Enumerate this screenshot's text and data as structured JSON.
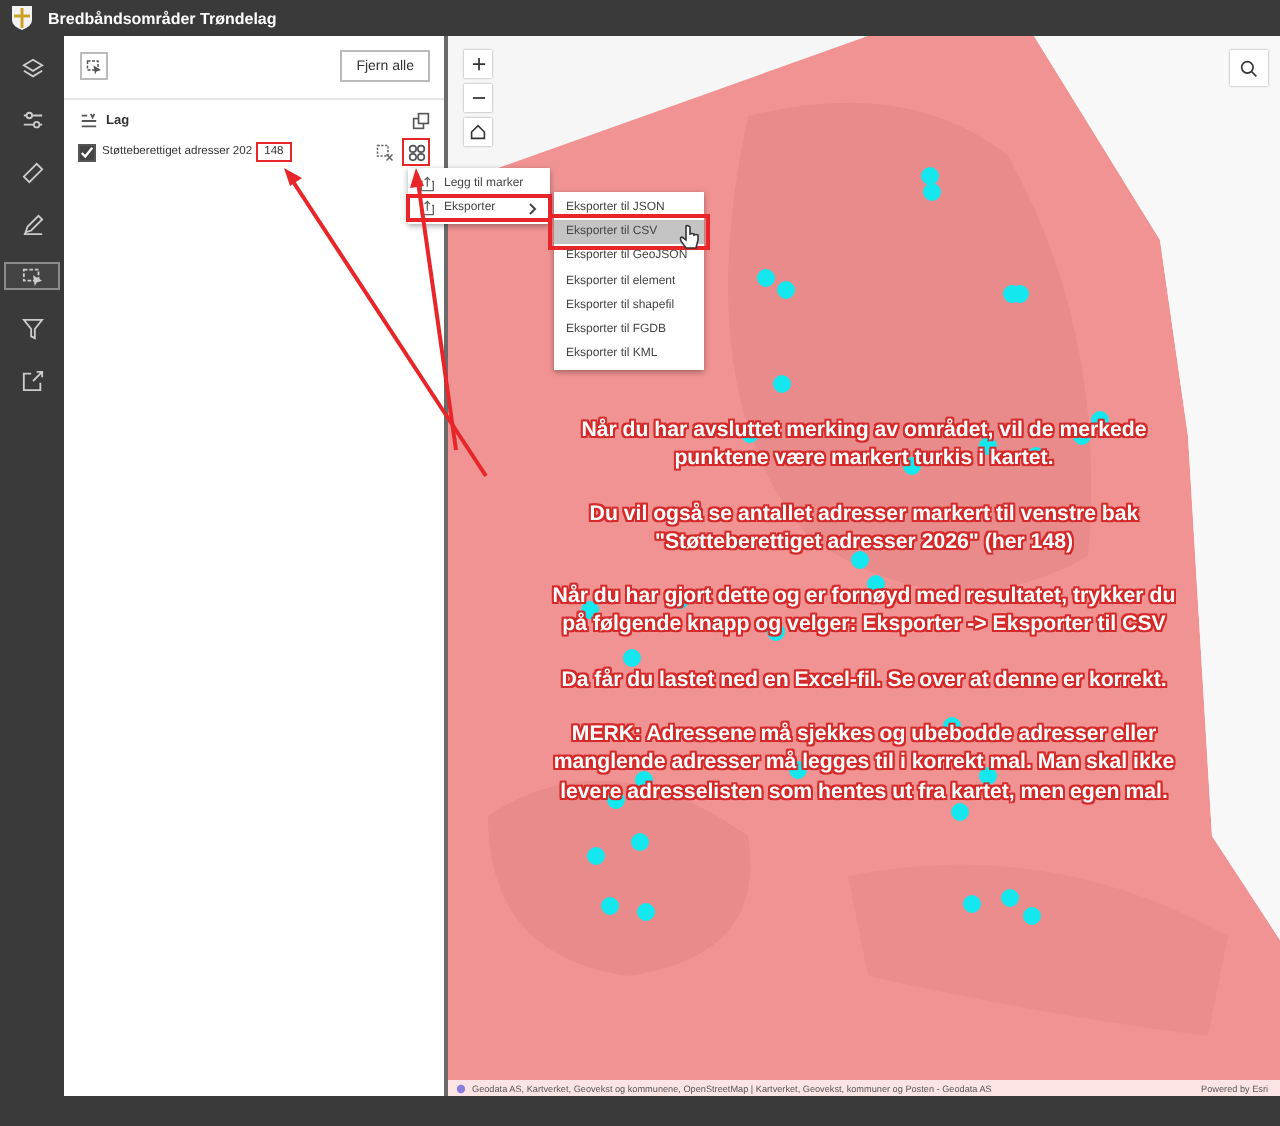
{
  "header": {
    "title": "Bredbåndsområder Trøndelag"
  },
  "rail": {
    "items": [
      {
        "selected": false
      },
      {
        "selected": false
      },
      {
        "selected": false
      },
      {
        "selected": false
      },
      {
        "selected": true
      },
      {
        "selected": false
      },
      {
        "selected": false
      }
    ]
  },
  "panel": {
    "clear_button": "Fjern alle",
    "section_title": "Lag",
    "layers": [
      {
        "label": "Støtteberettiget adresser 202",
        "checked": true,
        "count": "148",
        "count_highlighted": true,
        "actions_highlighted": true
      }
    ]
  },
  "layer_menu": {
    "items": [
      {
        "label": "Legg til marker",
        "has_submenu": false,
        "highlighted": false
      },
      {
        "label": "Eksporter",
        "has_submenu": true,
        "highlighted": true
      }
    ]
  },
  "export_menu": {
    "items": [
      {
        "label": "Eksporter til JSON",
        "selected": false,
        "highlighted": false
      },
      {
        "label": "Eksporter til CSV",
        "selected": true,
        "highlighted": true
      },
      {
        "label": "Eksporter til GeoJSON",
        "selected": false,
        "highlighted": false
      },
      {
        "label": "Eksporter til element",
        "selected": false,
        "highlighted": false
      },
      {
        "label": "Eksporter til shapefil",
        "selected": false,
        "highlighted": false
      },
      {
        "label": "Eksporter til FGDB",
        "selected": false,
        "highlighted": false
      },
      {
        "label": "Eksporter til KML",
        "selected": false,
        "highlighted": false
      }
    ]
  },
  "map": {
    "attribution": "Geodata AS, Kartverket, Geovekst og kommunene, OpenStreetMap | Kartverket, Geovekst, kommuner og Posten - Geodata AS",
    "powered_by": "Powered by Esri"
  },
  "instructions": [
    "Når du har avsluttet merking av området, vil de merkede\npunktene være markert turkis i kartet.",
    "Du vil også se antallet adresser markert til venstre bak\n\"Støtteberettiget adresser 2026\" (her 148)",
    "Når du har gjort dette og er fornøyd med resultatet, trykker du\npå følgende knapp og velger: Eksporter -> Eksporter til CSV",
    "Da får du lastet ned en Excel-fil. Se over at denne er korrekt.",
    "MERK: Adressene må sjekkes og ubebodde adresser eller\nmanglende adresser må legges til i korrekt mal. Man skal ikke\nlevere adresselisten som hentes ut fra kartet, men egen mal."
  ]
}
